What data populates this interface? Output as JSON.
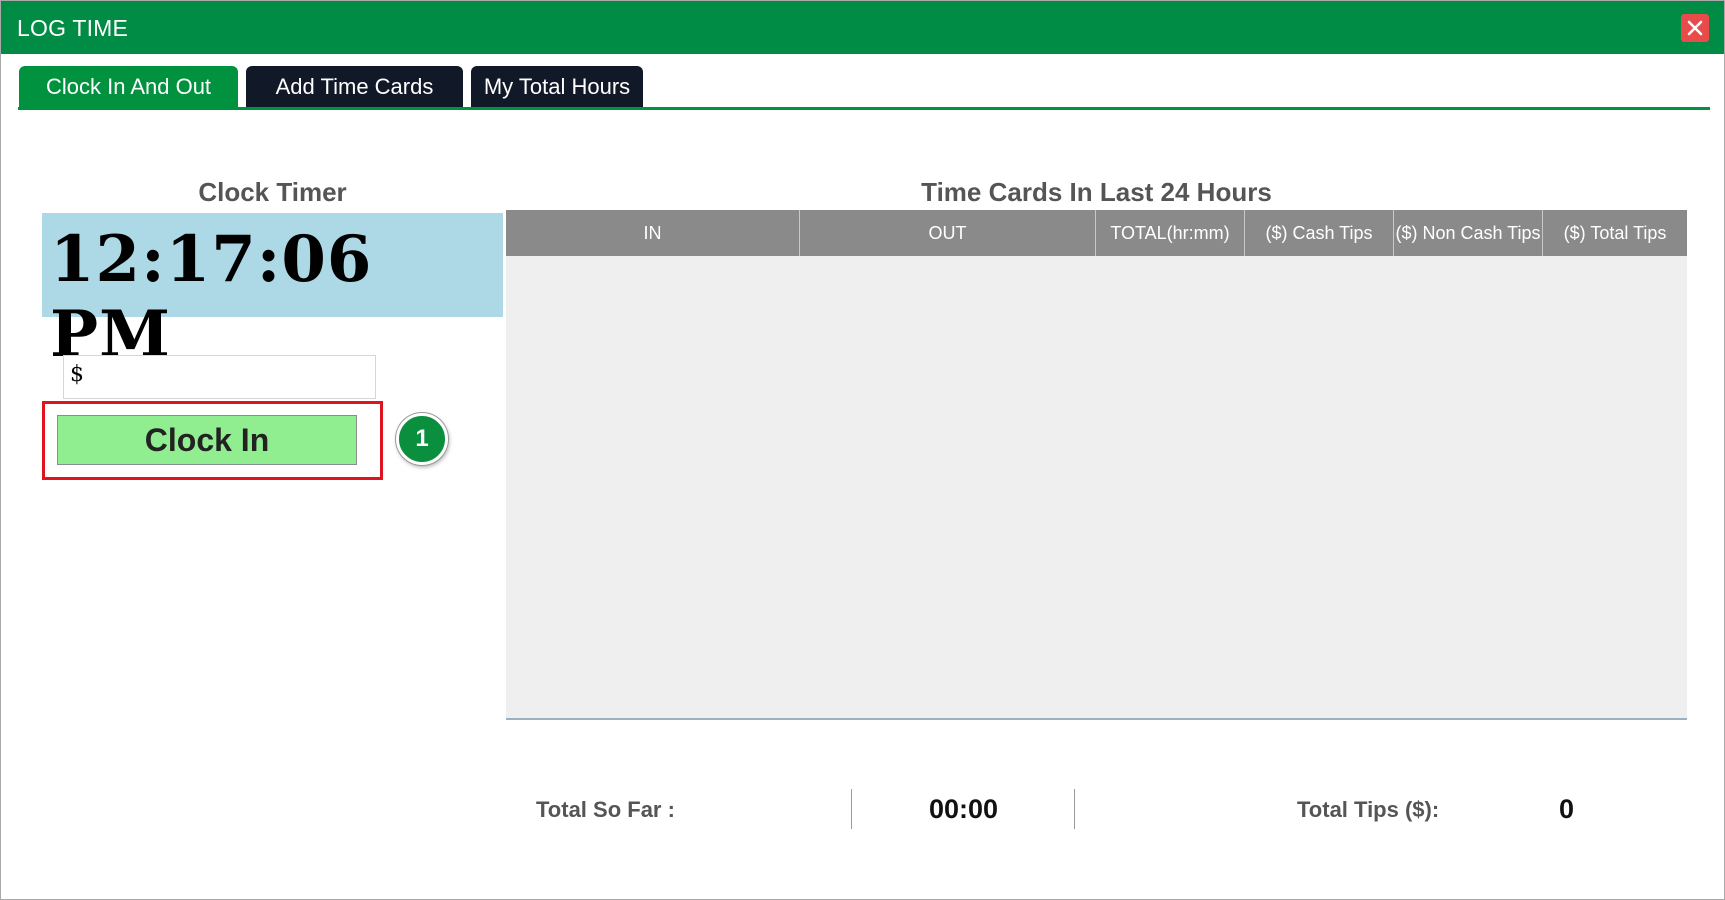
{
  "window": {
    "title": "LOG TIME",
    "close_icon": "close-icon"
  },
  "tabs": [
    {
      "label": "Clock In And Out",
      "active": true
    },
    {
      "label": "Add Time Cards",
      "active": false
    },
    {
      "label": "My Total Hours",
      "active": false
    }
  ],
  "clock": {
    "section_title": "Clock Timer",
    "time": "12:17:06 PM",
    "tips_prefix": "$",
    "clock_in_label": "Clock In",
    "step_number": "1"
  },
  "timecards": {
    "section_title": "Time Cards In Last 24 Hours",
    "columns": [
      "IN",
      "OUT",
      "TOTAL(hr:mm)",
      "($) Cash Tips",
      "($) Non Cash Tips",
      "($) Total Tips"
    ],
    "rows": []
  },
  "footer": {
    "total_so_far_label": "Total So Far :",
    "total_so_far_value": "00:00",
    "total_tips_label": "Total Tips ($):",
    "total_tips_value": "0"
  },
  "colors": {
    "brand_green": "#008c44",
    "tab_dark": "#111828",
    "clock_bg": "#add8e6",
    "button_green": "#90ee90",
    "highlight_red": "#e0141e",
    "grid_header": "#8a8a8a",
    "close_red": "#e94b4b"
  }
}
